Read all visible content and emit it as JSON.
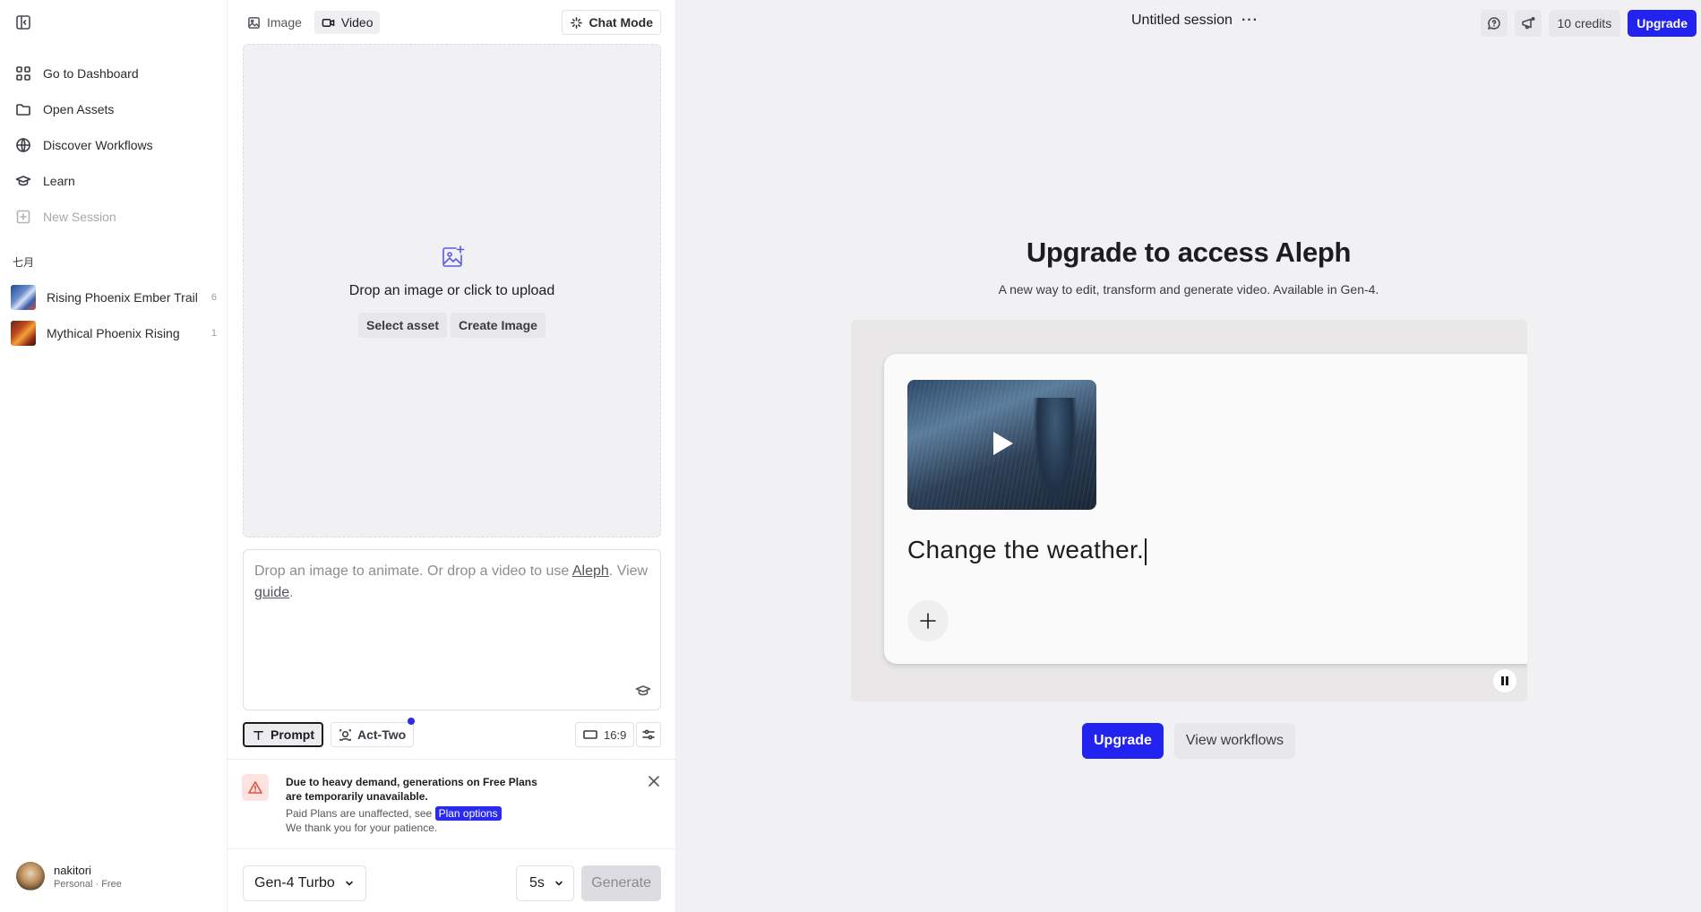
{
  "sidebar": {
    "nav": [
      {
        "label": "Go to Dashboard",
        "icon": "grid-icon"
      },
      {
        "label": "Open Assets",
        "icon": "folder-icon"
      },
      {
        "label": "Discover Workflows",
        "icon": "globe-icon"
      },
      {
        "label": "Learn",
        "icon": "graduation-cap-icon"
      },
      {
        "label": "New Session",
        "icon": "plus-square-icon",
        "disabled": true
      }
    ],
    "group_label": "七月",
    "sessions": [
      {
        "title": "Rising Phoenix Ember Trail",
        "count": "6"
      },
      {
        "title": "Mythical Phoenix Rising",
        "count": "1"
      }
    ],
    "user": {
      "name": "nakitori",
      "plan": "Personal · Free"
    }
  },
  "panel": {
    "tabs": [
      {
        "label": "Image",
        "icon": "image-icon",
        "active": false
      },
      {
        "label": "Video",
        "icon": "video-icon",
        "active": true
      }
    ],
    "chat_mode": "Chat Mode",
    "drop": {
      "text": "Drop an image or click to upload",
      "select_asset": "Select asset",
      "create_image": "Create Image"
    },
    "prompt": {
      "before": "Drop an image to animate. Or drop a video to use ",
      "link_aleph": "Aleph",
      "middle": ". View ",
      "link_guide": "guide",
      "after": "."
    },
    "modes": {
      "prompt": "Prompt",
      "act_two": "Act-Two"
    },
    "ratio": "16:9",
    "notice": {
      "title": "Due to heavy demand, generations on Free Plans are temporarily unavailable.",
      "sub_prefix": "Paid Plans are unaffected, see ",
      "plan_link": "Plan options",
      "thanks": "We thank you for your patience."
    },
    "footer": {
      "model": "Gen-4 Turbo",
      "duration": "5s",
      "generate": "Generate"
    }
  },
  "main": {
    "session_title": "Untitled session",
    "more": "···",
    "credits": "10 credits",
    "upgrade_top": "Upgrade",
    "hero_title": "Upgrade to access Aleph",
    "hero_sub": "A new way to edit, transform and generate video. Available in Gen-4.",
    "preview_text": "Change the weather.",
    "cta_upgrade": "Upgrade",
    "cta_workflows": "View workflows"
  },
  "colors": {
    "accent": "#2323f0",
    "warning": "#e1503f"
  }
}
